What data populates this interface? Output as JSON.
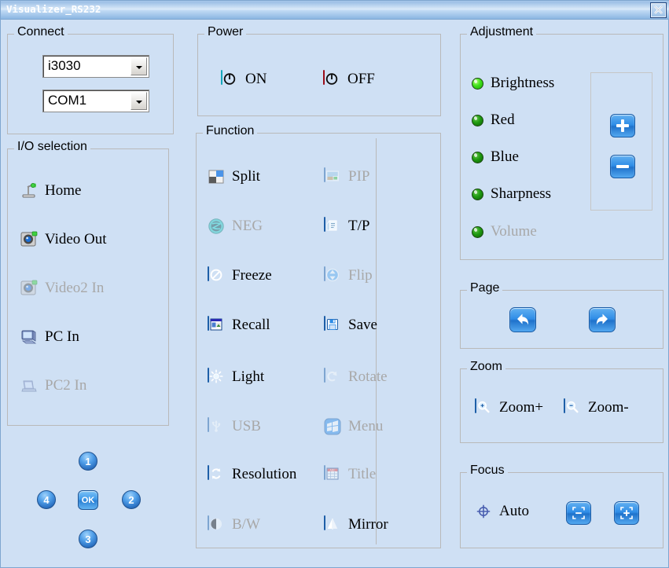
{
  "window": {
    "title": "Visualizer_RS232",
    "close_label": "close-icon"
  },
  "connect": {
    "legend": "Connect",
    "device": {
      "value": "i3030"
    },
    "port": {
      "value": "COM1"
    }
  },
  "io_selection": {
    "legend": "I/O selection",
    "items": [
      {
        "label": "Home",
        "icon": "document-camera-icon",
        "enabled": true
      },
      {
        "label": "Video Out",
        "icon": "camera-out-icon",
        "enabled": true
      },
      {
        "label": "Video2 In",
        "icon": "camera-in-icon",
        "enabled": false
      },
      {
        "label": "PC In",
        "icon": "desktop-pc-icon",
        "enabled": true
      },
      {
        "label": "PC2 In",
        "icon": "laptop-pc-icon",
        "enabled": false
      }
    ]
  },
  "navpad": {
    "up": "1",
    "right": "2",
    "down": "3",
    "left": "4",
    "ok": "OK"
  },
  "power": {
    "legend": "Power",
    "on_label": "ON",
    "off_label": "OFF",
    "on_color": "#22d3e8",
    "off_color": "#cf1f2f"
  },
  "function": {
    "legend": "Function",
    "left_column": [
      {
        "label": "Split",
        "icon": "split-screen-icon",
        "enabled": true
      },
      {
        "label": "NEG",
        "icon": "negative-icon",
        "enabled": false
      },
      {
        "label": "Freeze",
        "icon": "freeze-icon",
        "enabled": true
      },
      {
        "label": "Recall",
        "icon": "recall-icon",
        "enabled": true
      },
      {
        "label": "Light",
        "icon": "lamp-icon",
        "enabled": true
      },
      {
        "label": "USB",
        "icon": "usb-icon",
        "enabled": false
      },
      {
        "label": "Resolution",
        "icon": "resolution-icon",
        "enabled": true
      },
      {
        "label": "B/W",
        "icon": "black-white-icon",
        "enabled": false
      }
    ],
    "right_column": [
      {
        "label": "PIP",
        "icon": "pip-icon",
        "enabled": false
      },
      {
        "label": "T/P",
        "icon": "text-photo-icon",
        "enabled": true
      },
      {
        "label": "Flip",
        "icon": "flip-icon",
        "enabled": false
      },
      {
        "label": "Save",
        "icon": "save-disk-icon",
        "enabled": true
      },
      {
        "label": "Rotate",
        "icon": "rotate-icon",
        "enabled": false
      },
      {
        "label": "Menu",
        "icon": "menu-icon",
        "enabled": false
      },
      {
        "label": "Title",
        "icon": "title-table-icon",
        "enabled": false
      },
      {
        "label": "Mirror",
        "icon": "mirror-icon",
        "enabled": true
      }
    ]
  },
  "adjustment": {
    "legend": "Adjustment",
    "items": [
      {
        "label": "Brightness",
        "selected": true
      },
      {
        "label": "Red",
        "selected": false
      },
      {
        "label": "Blue",
        "selected": false
      },
      {
        "label": "Sharpness",
        "selected": false
      },
      {
        "label": "Volume",
        "selected": false,
        "enabled": false
      }
    ],
    "plus_label": "plus-button",
    "minus_label": "minus-button"
  },
  "page": {
    "legend": "Page",
    "prev_label": "page-back-icon",
    "next_label": "page-forward-icon"
  },
  "zoom": {
    "legend": "Zoom",
    "in_label": "Zoom+",
    "out_label": "Zoom-"
  },
  "focus": {
    "legend": "Focus",
    "auto_label": "Auto",
    "near_label": "focus-near-button",
    "far_label": "focus-far-button"
  },
  "colors": {
    "background": "#cfe0f4",
    "accent_blue": "#2f8de7",
    "title_bar": "#9ec0e6",
    "disabled_text": "#a8a8a8"
  }
}
